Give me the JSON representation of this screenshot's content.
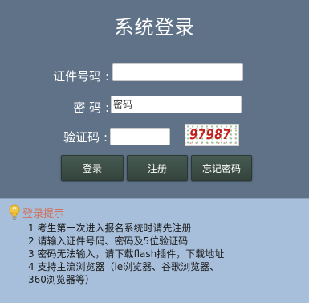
{
  "login": {
    "title": "系统登录",
    "id_label": "证件号码 :",
    "id_value": "",
    "password_label": "密 码 :",
    "password_placeholder": "密码",
    "captcha_label": "验证码 :",
    "captcha_value": "",
    "captcha_image_text": "97987"
  },
  "buttons": {
    "login": "登录",
    "register": "注册",
    "forgot": "忘记密码"
  },
  "tips": {
    "title": "登录提示",
    "items": [
      "1 考生第一次进入报名系统时请先注册",
      "2 请输入证件号码、密码及5位验证码",
      "3 密码无法输入，请下载flash插件，下载地址",
      "4 支持主流浏览器（ie浏览器、谷歌浏览器、",
      "360浏览器等）"
    ]
  },
  "colors": {
    "panel_bg": "#5f7287",
    "tips_bg": "#a7bfda",
    "button_bg": "#3d4f47",
    "tips_title": "#d0705a",
    "captcha_text": "#c31d1d"
  },
  "icons": {
    "tips_icon": "lightbulb-icon"
  }
}
